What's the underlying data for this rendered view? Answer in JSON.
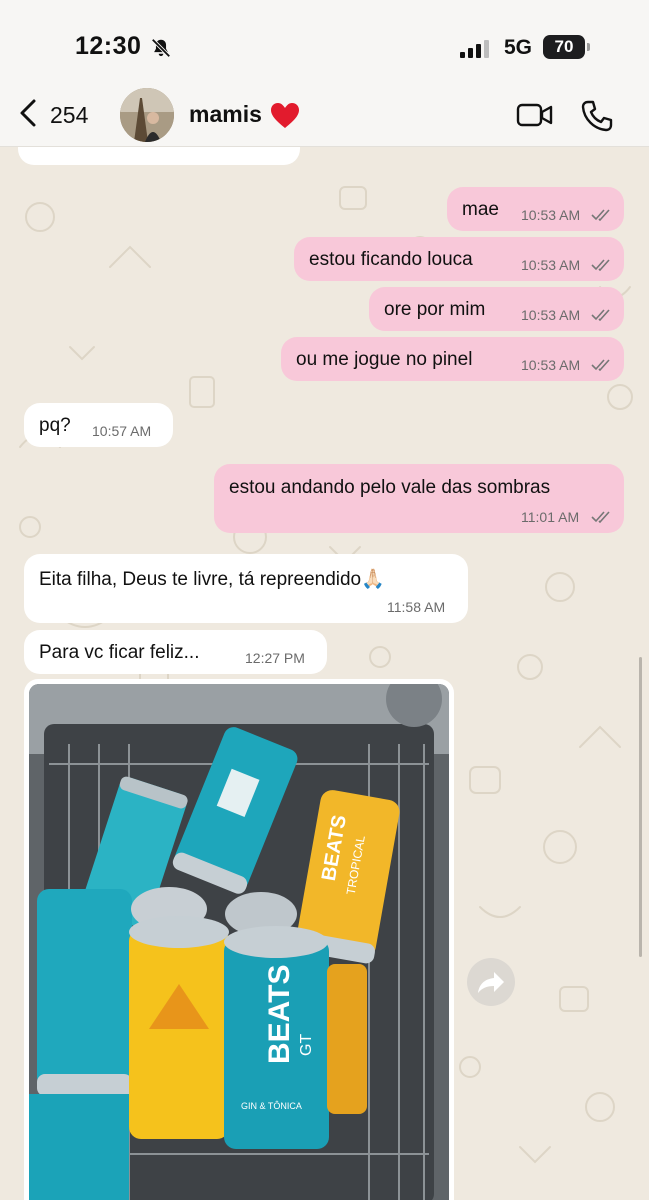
{
  "status_bar": {
    "time": "12:30",
    "network": "5G",
    "battery": "70"
  },
  "header": {
    "back_count": "254",
    "contact_name": "mamis"
  },
  "messages": [
    {
      "direction": "out",
      "text": "mae",
      "time": "10:53 AM"
    },
    {
      "direction": "out",
      "text": "estou ficando louca",
      "time": "10:53 AM"
    },
    {
      "direction": "out",
      "text": "ore por mim",
      "time": "10:53 AM"
    },
    {
      "direction": "out",
      "text": "ou me jogue no pinel",
      "time": "10:53 AM"
    },
    {
      "direction": "in",
      "text": "pq?",
      "time": "10:57 AM"
    },
    {
      "direction": "out",
      "text": "estou andando pelo vale das sombras",
      "time": "11:01 AM"
    },
    {
      "direction": "in",
      "text": "Eita filha, Deus te livre, tá repreendido🙏🏻",
      "time": "11:58 AM"
    },
    {
      "direction": "in",
      "text": "Para vc ficar feliz...",
      "time": "12:27 PM"
    }
  ],
  "photo": {
    "brand_text": "BEATS",
    "flavor_1": "TROPICAL",
    "flavor_2": "GT",
    "flavor_3": "GIN & TÔNICA"
  },
  "icons": [
    "bell-slash-icon",
    "signal-icon",
    "chevron-left-icon",
    "heart-icon",
    "video-call-icon",
    "phone-icon",
    "double-check-icon",
    "forward-icon"
  ]
}
